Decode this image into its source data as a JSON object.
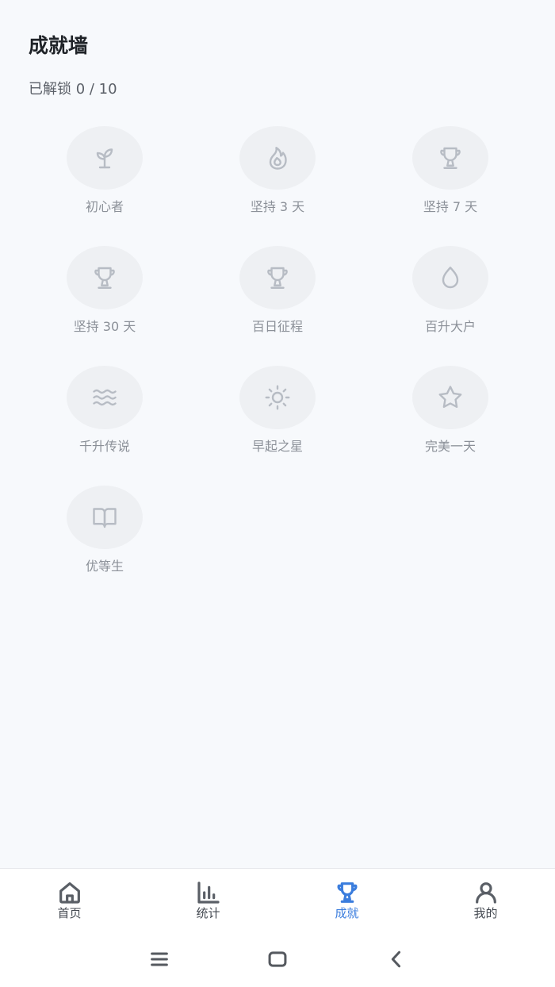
{
  "header": {
    "title": "成就墙",
    "unlocked_label": "已解锁 0 / 10"
  },
  "achievements": [
    {
      "label": "初心者",
      "icon": "sprout-icon",
      "unlocked": false
    },
    {
      "label": "坚持 3 天",
      "icon": "flame-icon",
      "unlocked": false
    },
    {
      "label": "坚持 7 天",
      "icon": "trophy-icon",
      "unlocked": false
    },
    {
      "label": "坚持 30 天",
      "icon": "trophy-icon",
      "unlocked": false
    },
    {
      "label": "百日征程",
      "icon": "trophy-icon",
      "unlocked": false
    },
    {
      "label": "百升大户",
      "icon": "droplet-icon",
      "unlocked": false
    },
    {
      "label": "千升传说",
      "icon": "waves-icon",
      "unlocked": false
    },
    {
      "label": "早起之星",
      "icon": "sun-icon",
      "unlocked": false
    },
    {
      "label": "完美一天",
      "icon": "star-icon",
      "unlocked": false
    },
    {
      "label": "优等生",
      "icon": "book-icon",
      "unlocked": false
    }
  ],
  "tabbar": {
    "tabs": [
      {
        "label": "首页",
        "icon": "home-icon",
        "active": false
      },
      {
        "label": "统计",
        "icon": "bar-chart-icon",
        "active": false
      },
      {
        "label": "成就",
        "icon": "trophy-icon",
        "active": true
      },
      {
        "label": "我的",
        "icon": "user-icon",
        "active": false
      }
    ]
  },
  "colors": {
    "accent": "#3b7ddd",
    "locked_icon": "#b7bcc4",
    "locked_bg": "#eef0f3",
    "page_bg": "#f7f9fc"
  },
  "system_nav": {
    "buttons": [
      "menu-icon",
      "home-square-icon",
      "back-icon"
    ]
  }
}
